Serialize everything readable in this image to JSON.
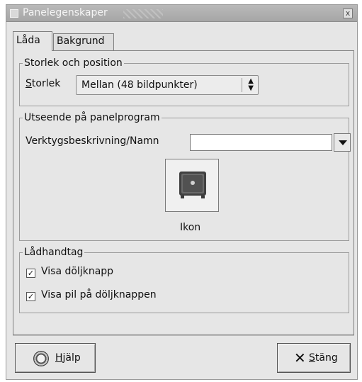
{
  "window": {
    "title": "Panelegenskaper",
    "close_label": "x"
  },
  "tabs": [
    {
      "label": "Låda",
      "active": true
    },
    {
      "label": "Bakgrund",
      "active": false
    }
  ],
  "size_frame": {
    "title": "Storlek och position",
    "size_label": "Storlek",
    "size_value": "Mellan (48 bildpunkter)"
  },
  "appearance_frame": {
    "title": "Utseende på panelprogram",
    "tooltip_label": "Verktygsbeskrivning/Namn",
    "tooltip_value": "",
    "icon_label": "Ikon",
    "icon_name": "drawer-safe-icon"
  },
  "handle_frame": {
    "title": "Lådhandtag",
    "checkbox1_label": "Visa döljknapp",
    "checkbox1_checked": true,
    "checkbox2_label": "Visa pil på döljknappen",
    "checkbox2_checked": true
  },
  "buttons": {
    "help_label": "Hjälp",
    "close_label": "Stäng"
  },
  "icons": {
    "help": "lifebuoy-icon",
    "close": "x-icon"
  },
  "colors": {
    "window_bg": "#e6e6e6",
    "title_bg": "#aeaeae"
  }
}
